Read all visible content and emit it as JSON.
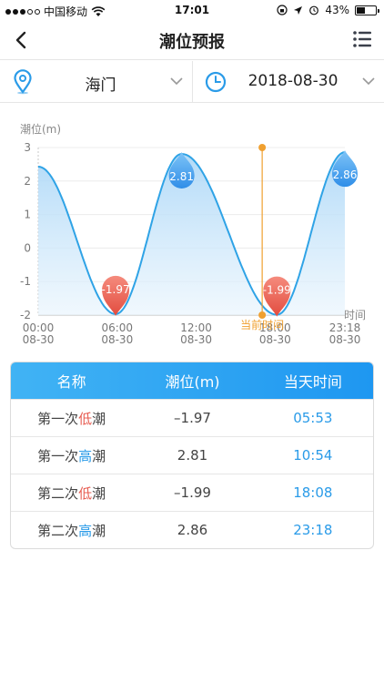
{
  "status_bar": {
    "carrier": "中国移动",
    "time": "17:01",
    "battery": "43%",
    "battery_level": 0.43
  },
  "nav": {
    "title": "潮位预报",
    "back_icon": "chevron-left-icon",
    "menu_icon": "list-menu-icon"
  },
  "selectors": {
    "location": "海门",
    "date": "2018-08-30",
    "location_icon": "map-pin-icon",
    "date_icon": "clock-icon"
  },
  "chart_data": {
    "type": "area",
    "ylabel": "潮位(m)",
    "xlabel": "时间",
    "ylim": [
      -2,
      3
    ],
    "yticks": [
      "3",
      "2",
      "1",
      "0",
      "-1",
      "-2"
    ],
    "xticks": [
      {
        "h": 0,
        "time": "00:00",
        "date": "08-30"
      },
      {
        "h": 6,
        "time": "06:00",
        "date": "08-30"
      },
      {
        "h": 12,
        "time": "12:00",
        "date": "08-30"
      },
      {
        "h": 18,
        "time": "18:00",
        "date": "08-30"
      },
      {
        "h": 23.3,
        "time": "23:18",
        "date": "08-30"
      }
    ],
    "xlim": [
      0,
      23.3
    ],
    "series": [
      {
        "points": [
          {
            "x": 0,
            "y": 2.43
          },
          {
            "x": 5.883,
            "y": -1.97
          },
          {
            "x": 10.9,
            "y": 2.81
          },
          {
            "x": 18.133,
            "y": -1.99
          },
          {
            "x": 23.3,
            "y": 2.86
          }
        ]
      }
    ],
    "extremes": [
      {
        "x": 5.883,
        "y": -1.97,
        "label": "-1.97",
        "kind": "low"
      },
      {
        "x": 10.9,
        "y": 2.81,
        "label": "2.81",
        "kind": "high"
      },
      {
        "x": 18.133,
        "y": -1.99,
        "label": "-1.99",
        "kind": "low"
      },
      {
        "x": 23.3,
        "y": 2.86,
        "label": "2.86",
        "kind": "high"
      }
    ],
    "current_time": {
      "x": 17.017,
      "label": "当前时间"
    },
    "colors": {
      "line": "#2fa3e6",
      "area_top": "#a9d6f7",
      "area_bottom": "#eaf5fd",
      "low_marker": "#ec5f50",
      "high_marker": "#3b9ff0",
      "current": "#f0a030"
    }
  },
  "table": {
    "headers": [
      "名称",
      "潮位(m)",
      "当天时间"
    ],
    "rows": [
      {
        "prefix": "第一次",
        "kind": "低",
        "suffix": "潮",
        "level": "–1.97",
        "time": "05:53"
      },
      {
        "prefix": "第一次",
        "kind": "高",
        "suffix": "潮",
        "level": "2.81",
        "time": "10:54"
      },
      {
        "prefix": "第二次",
        "kind": "低",
        "suffix": "潮",
        "level": "–1.99",
        "time": "18:08"
      },
      {
        "prefix": "第二次",
        "kind": "高",
        "suffix": "潮",
        "level": "2.86",
        "time": "23:18"
      }
    ]
  },
  "colors": {
    "accent": "#1e97f1",
    "low": "#e75b50",
    "high": "#2a9be8"
  }
}
